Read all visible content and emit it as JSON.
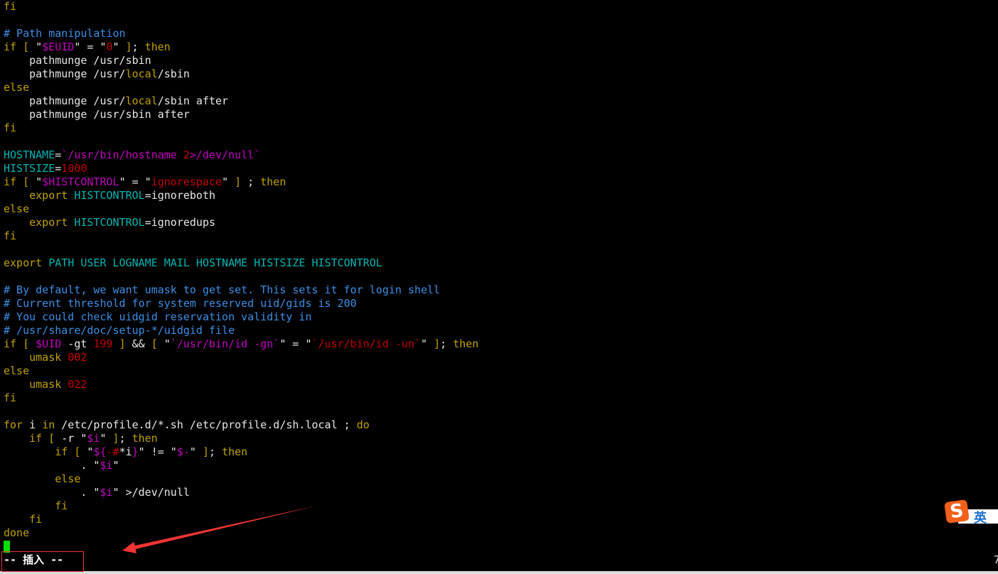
{
  "editor": {
    "lines": [
      {
        "segments": [
          {
            "t": "k",
            "text": "fi"
          }
        ]
      },
      {
        "segments": []
      },
      {
        "segments": [
          {
            "t": "cm",
            "text": "# Path manipulation"
          }
        ]
      },
      {
        "segments": [
          {
            "t": "k",
            "text": "if [ "
          },
          {
            "t": "w",
            "text": "\""
          },
          {
            "t": "m",
            "text": "$EUID"
          },
          {
            "t": "w",
            "text": "\" = \""
          },
          {
            "t": "r",
            "text": "0"
          },
          {
            "t": "w",
            "text": "\" "
          },
          {
            "t": "k",
            "text": "]"
          },
          {
            "t": "w",
            "text": "; "
          },
          {
            "t": "k",
            "text": "then"
          }
        ]
      },
      {
        "segments": [
          {
            "t": "w",
            "text": "    pathmunge /usr/sbin"
          }
        ]
      },
      {
        "segments": [
          {
            "t": "w",
            "text": "    pathmunge /usr/"
          },
          {
            "t": "k",
            "text": "local"
          },
          {
            "t": "w",
            "text": "/sbin"
          }
        ]
      },
      {
        "segments": [
          {
            "t": "k",
            "text": "else"
          }
        ]
      },
      {
        "segments": [
          {
            "t": "w",
            "text": "    pathmunge /usr/"
          },
          {
            "t": "k",
            "text": "local"
          },
          {
            "t": "w",
            "text": "/sbin after"
          }
        ]
      },
      {
        "segments": [
          {
            "t": "w",
            "text": "    pathmunge /usr/sbin after"
          }
        ]
      },
      {
        "segments": [
          {
            "t": "k",
            "text": "fi"
          }
        ]
      },
      {
        "segments": []
      },
      {
        "segments": [
          {
            "t": "c",
            "text": "HOSTNAME"
          },
          {
            "t": "w",
            "text": "="
          },
          {
            "t": "m",
            "text": "`/usr/bin/hostname "
          },
          {
            "t": "r",
            "text": "2"
          },
          {
            "t": "m",
            "text": ">/dev/null`"
          }
        ]
      },
      {
        "segments": [
          {
            "t": "c",
            "text": "HISTSIZE"
          },
          {
            "t": "w",
            "text": "="
          },
          {
            "t": "r",
            "text": "1000"
          }
        ]
      },
      {
        "segments": [
          {
            "t": "k",
            "text": "if [ "
          },
          {
            "t": "w",
            "text": "\""
          },
          {
            "t": "m",
            "text": "$HISTCONTROL"
          },
          {
            "t": "w",
            "text": "\" = \""
          },
          {
            "t": "r",
            "text": "ignorespace"
          },
          {
            "t": "w",
            "text": "\" "
          },
          {
            "t": "k",
            "text": "]"
          },
          {
            "t": "w",
            "text": " ; "
          },
          {
            "t": "k",
            "text": "then"
          }
        ]
      },
      {
        "segments": [
          {
            "t": "k",
            "text": "    export "
          },
          {
            "t": "c",
            "text": "HISTCONTROL"
          },
          {
            "t": "w",
            "text": "=ignoreboth"
          }
        ]
      },
      {
        "segments": [
          {
            "t": "k",
            "text": "else"
          }
        ]
      },
      {
        "segments": [
          {
            "t": "k",
            "text": "    export "
          },
          {
            "t": "c",
            "text": "HISTCONTROL"
          },
          {
            "t": "w",
            "text": "=ignoredups"
          }
        ]
      },
      {
        "segments": [
          {
            "t": "k",
            "text": "fi"
          }
        ]
      },
      {
        "segments": []
      },
      {
        "segments": [
          {
            "t": "k",
            "text": "export "
          },
          {
            "t": "c",
            "text": "PATH USER LOGNAME MAIL HOSTNAME HISTSIZE HISTCONTROL"
          }
        ]
      },
      {
        "segments": []
      },
      {
        "segments": [
          {
            "t": "cm",
            "text": "# By default, we want umask to get set. This sets it for login shell"
          }
        ]
      },
      {
        "segments": [
          {
            "t": "cm",
            "text": "# Current threshold for system reserved uid/gids is 200"
          }
        ]
      },
      {
        "segments": [
          {
            "t": "cm",
            "text": "# You could check uidgid reservation validity in"
          }
        ]
      },
      {
        "segments": [
          {
            "t": "cm",
            "text": "# /usr/share/doc/setup-*/uidgid file"
          }
        ]
      },
      {
        "segments": [
          {
            "t": "k",
            "text": "if [ "
          },
          {
            "t": "m",
            "text": "$UID"
          },
          {
            "t": "w",
            "text": " -gt "
          },
          {
            "t": "r",
            "text": "199"
          },
          {
            "t": "w",
            "text": " "
          },
          {
            "t": "k",
            "text": "]"
          },
          {
            "t": "w",
            "text": " && "
          },
          {
            "t": "k",
            "text": "[ "
          },
          {
            "t": "w",
            "text": "\""
          },
          {
            "t": "m",
            "text": "`/usr/bin/id -gn`"
          },
          {
            "t": "w",
            "text": "\" = \""
          },
          {
            "t": "r",
            "text": "`/usr/bin/id -un`"
          },
          {
            "t": "w",
            "text": "\" "
          },
          {
            "t": "k",
            "text": "]"
          },
          {
            "t": "w",
            "text": "; "
          },
          {
            "t": "k",
            "text": "then"
          }
        ]
      },
      {
        "segments": [
          {
            "t": "k",
            "text": "    umask "
          },
          {
            "t": "r",
            "text": "002"
          }
        ]
      },
      {
        "segments": [
          {
            "t": "k",
            "text": "else"
          }
        ]
      },
      {
        "segments": [
          {
            "t": "k",
            "text": "    umask "
          },
          {
            "t": "r",
            "text": "022"
          }
        ]
      },
      {
        "segments": [
          {
            "t": "k",
            "text": "fi"
          }
        ]
      },
      {
        "segments": []
      },
      {
        "segments": [
          {
            "t": "k",
            "text": "for"
          },
          {
            "t": "w",
            "text": " i "
          },
          {
            "t": "k",
            "text": "in"
          },
          {
            "t": "w",
            "text": " /etc/profile.d/*.sh /etc/profile.d/sh.local ; "
          },
          {
            "t": "k",
            "text": "do"
          }
        ]
      },
      {
        "segments": [
          {
            "t": "k",
            "text": "    if [ "
          },
          {
            "t": "w",
            "text": "-r \""
          },
          {
            "t": "m",
            "text": "$i"
          },
          {
            "t": "w",
            "text": "\" "
          },
          {
            "t": "k",
            "text": "]"
          },
          {
            "t": "w",
            "text": "; "
          },
          {
            "t": "k",
            "text": "then"
          }
        ]
      },
      {
        "segments": [
          {
            "t": "k",
            "text": "        if [ "
          },
          {
            "t": "w",
            "text": "\""
          },
          {
            "t": "m",
            "text": "${"
          },
          {
            "t": "r",
            "text": "-#"
          },
          {
            "t": "w",
            "text": "*i"
          },
          {
            "t": "m",
            "text": "}"
          },
          {
            "t": "w",
            "text": "\" != \""
          },
          {
            "t": "m",
            "text": "$-"
          },
          {
            "t": "w",
            "text": "\" "
          },
          {
            "t": "k",
            "text": "]"
          },
          {
            "t": "w",
            "text": "; "
          },
          {
            "t": "k",
            "text": "then"
          }
        ]
      },
      {
        "segments": [
          {
            "t": "w",
            "text": "            . \""
          },
          {
            "t": "m",
            "text": "$i"
          },
          {
            "t": "w",
            "text": "\""
          }
        ]
      },
      {
        "segments": [
          {
            "t": "k",
            "text": "        else"
          }
        ]
      },
      {
        "segments": [
          {
            "t": "w",
            "text": "            . \""
          },
          {
            "t": "m",
            "text": "$i"
          },
          {
            "t": "w",
            "text": "\" >/dev/null"
          }
        ]
      },
      {
        "segments": [
          {
            "t": "k",
            "text": "        fi"
          }
        ]
      },
      {
        "segments": [
          {
            "t": "k",
            "text": "    fi"
          }
        ]
      },
      {
        "segments": [
          {
            "t": "k",
            "text": "done"
          }
        ]
      }
    ],
    "cursor_color": "#00e000"
  },
  "status": {
    "mode": "-- 插入 --",
    "ruler_partial": "7"
  },
  "ime": {
    "logo": "S",
    "language": "英"
  },
  "colors": {
    "keyword": "#bfa100",
    "identifier": "#00b5b5",
    "special": "#c000c0",
    "constant": "#c40000",
    "comment": "#3b8fe6",
    "annotation": "#f03535"
  }
}
